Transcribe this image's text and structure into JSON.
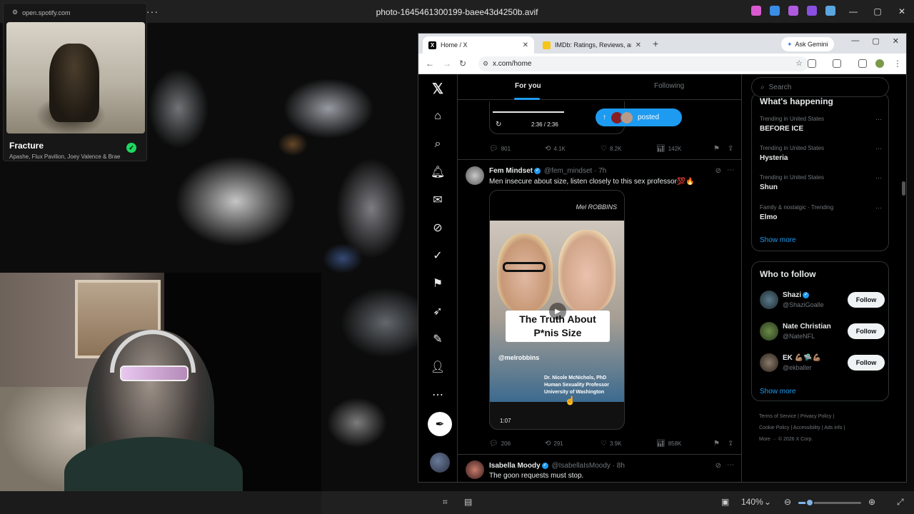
{
  "viewer": {
    "title": "photo-1645461300199-baee43d4250b.avif",
    "more_label": "···",
    "zoom": "140%",
    "zoom_fraction": 0.18,
    "win_min": "—",
    "win_max": "▢",
    "win_close": "✕",
    "bottom_icons": [
      "crop-icon",
      "info-icon",
      "fit-icon",
      "zoom-out-icon",
      "zoom-in-icon",
      "fullscreen-icon"
    ]
  },
  "tray": {
    "colors": [
      "#d95ad0",
      "#3a8ee6",
      "#b05ae0",
      "#8a4fe0",
      "#5aa6e0"
    ]
  },
  "spotify": {
    "url": "open.spotify.com",
    "track": "Fracture",
    "artists": "Apashe, Flux Pavilion, Joey Valence & Brae",
    "saved_icon": "✓",
    "accent": "#1ed760"
  },
  "browser": {
    "tabs": [
      {
        "label": "Home / X",
        "favicon": "X",
        "active": true
      },
      {
        "label": "IMDb: Ratings, Reviews, and Wh",
        "favicon": "IMDb",
        "active": false
      }
    ],
    "new_tab": "+",
    "gemini": "Ask Gemini",
    "url": "x.com/home",
    "ctrls": [
      "—",
      "▢",
      "✕"
    ]
  },
  "x": {
    "tabs": [
      "For you",
      "Following"
    ],
    "accent": "#1d9bf0",
    "posted_pill": "posted",
    "prev_post": {
      "time": "2:36 / 2:36",
      "replies": "801",
      "reposts": "4.1K",
      "likes": "8.2K",
      "views": "142K"
    },
    "post": {
      "name": "Fem Mindset",
      "handle": "@fem_mindset · 7h",
      "text": "Men insecure about size, listen closely to this sex professor💯🔥",
      "video_brand": "Mel ROBBINS",
      "headline_line1": "The Truth About",
      "headline_line2": "P*nis Size",
      "video_handle": "@melrobbins",
      "caption1": "Dr. Nicole McNichols, PhD",
      "caption2": "Human Sexuality Professor",
      "caption3": "University of Washington",
      "duration": "1:07",
      "replies": "206",
      "reposts": "291",
      "likes": "3.9K",
      "views": "858K"
    },
    "post2": {
      "name": "Isabella Moody",
      "handle": "@IsabellaIsMoody · 8h",
      "text": "The goon requests must stop."
    },
    "search_placeholder": "Search",
    "trends_head": "What's happening",
    "trends": [
      {
        "meta": "Trending in United States",
        "name": "BEFORE ICE"
      },
      {
        "meta": "Trending in United States",
        "name": "Hysteria"
      },
      {
        "meta": "Trending in United States",
        "name": "Shun"
      },
      {
        "meta": "Family & nostalgic · Trending",
        "name": "Elmo"
      }
    ],
    "show_more": "Show more",
    "wtf_title": "Who to follow",
    "follow_label": "Follow",
    "wtf": [
      {
        "name": "Shazi",
        "handle": "@ShaziGoalle"
      },
      {
        "name": "Nate Christian",
        "handle": "@NateNFL"
      },
      {
        "name": "EK 💪🏽🛸💪🏽",
        "handle": "@ekballer"
      }
    ],
    "footer": {
      "terms": "Terms of Service",
      "privacy": "Privacy Policy",
      "cookie": "Cookie Policy",
      "accessibility": "Accessibility",
      "ads": "Ads info",
      "more": "More ···",
      "copyright": "© 2026 X Corp."
    }
  }
}
